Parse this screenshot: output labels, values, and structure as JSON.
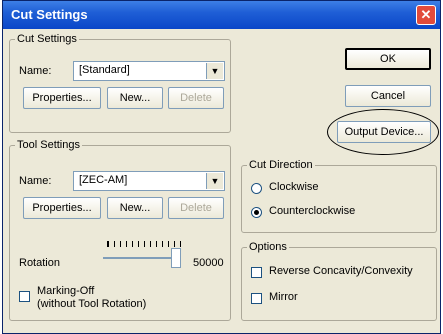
{
  "window": {
    "title": "Cut Settings",
    "close_icon": "close-icon"
  },
  "cut_settings": {
    "legend": "Cut Settings",
    "name_label": "Name:",
    "name_value": "[Standard]",
    "properties": "Properties...",
    "new": "New...",
    "delete": "Delete"
  },
  "tool_settings": {
    "legend": "Tool Settings",
    "name_label": "Name:",
    "name_value": "[ZEC-AM]",
    "properties": "Properties...",
    "new": "New...",
    "delete": "Delete",
    "rotation_label": "Rotation",
    "rotation_value": "50000",
    "marking_off": "Marking-Off",
    "marking_off_sub": "(without Tool Rotation)"
  },
  "buttons": {
    "ok": "OK",
    "cancel": "Cancel",
    "output_device": "Output Device..."
  },
  "cut_direction": {
    "legend": "Cut Direction",
    "clockwise": "Clockwise",
    "counterclockwise": "Counterclockwise",
    "selected": "counterclockwise"
  },
  "options": {
    "legend": "Options",
    "reverse": "Reverse Concavity/Convexity",
    "mirror": "Mirror"
  }
}
